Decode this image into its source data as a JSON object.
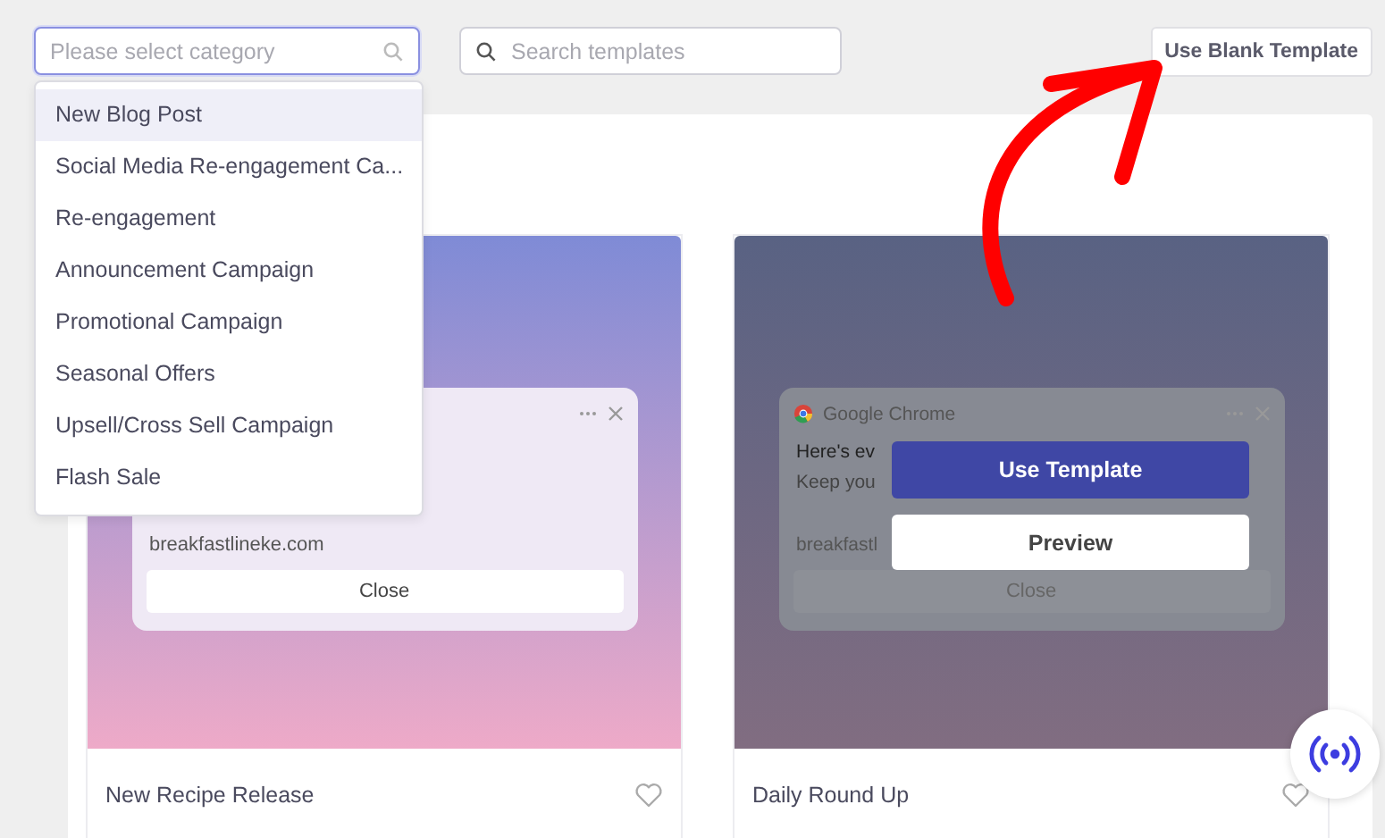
{
  "category_select": {
    "placeholder": "Please select category",
    "expanded": true,
    "options": [
      {
        "label": "New Blog Post",
        "selected": true
      },
      {
        "label": "Social Media Re-engagement Ca...",
        "selected": false
      },
      {
        "label": "Re-engagement",
        "selected": false
      },
      {
        "label": "Announcement Campaign",
        "selected": false
      },
      {
        "label": "Promotional Campaign",
        "selected": false
      },
      {
        "label": "Seasonal Offers",
        "selected": false
      },
      {
        "label": "Upsell/Cross Sell Campaign",
        "selected": false
      },
      {
        "label": "Flash Sale",
        "selected": false
      }
    ]
  },
  "search": {
    "placeholder": "Search templates"
  },
  "blank_template_button": "Use Blank Template",
  "templates": [
    {
      "name": "New Recipe Release",
      "hovered": false,
      "preview": {
        "site": "breakfastlineke.com",
        "close": "Close"
      }
    },
    {
      "name": "Daily Round Up",
      "hovered": true,
      "preview": {
        "browser": "Google Chrome",
        "lines": [
          "Here's ev",
          "Keep you"
        ],
        "site": "breakfastl",
        "close": "Close"
      },
      "use_button": "Use Template",
      "preview_button": "Preview"
    }
  ]
}
